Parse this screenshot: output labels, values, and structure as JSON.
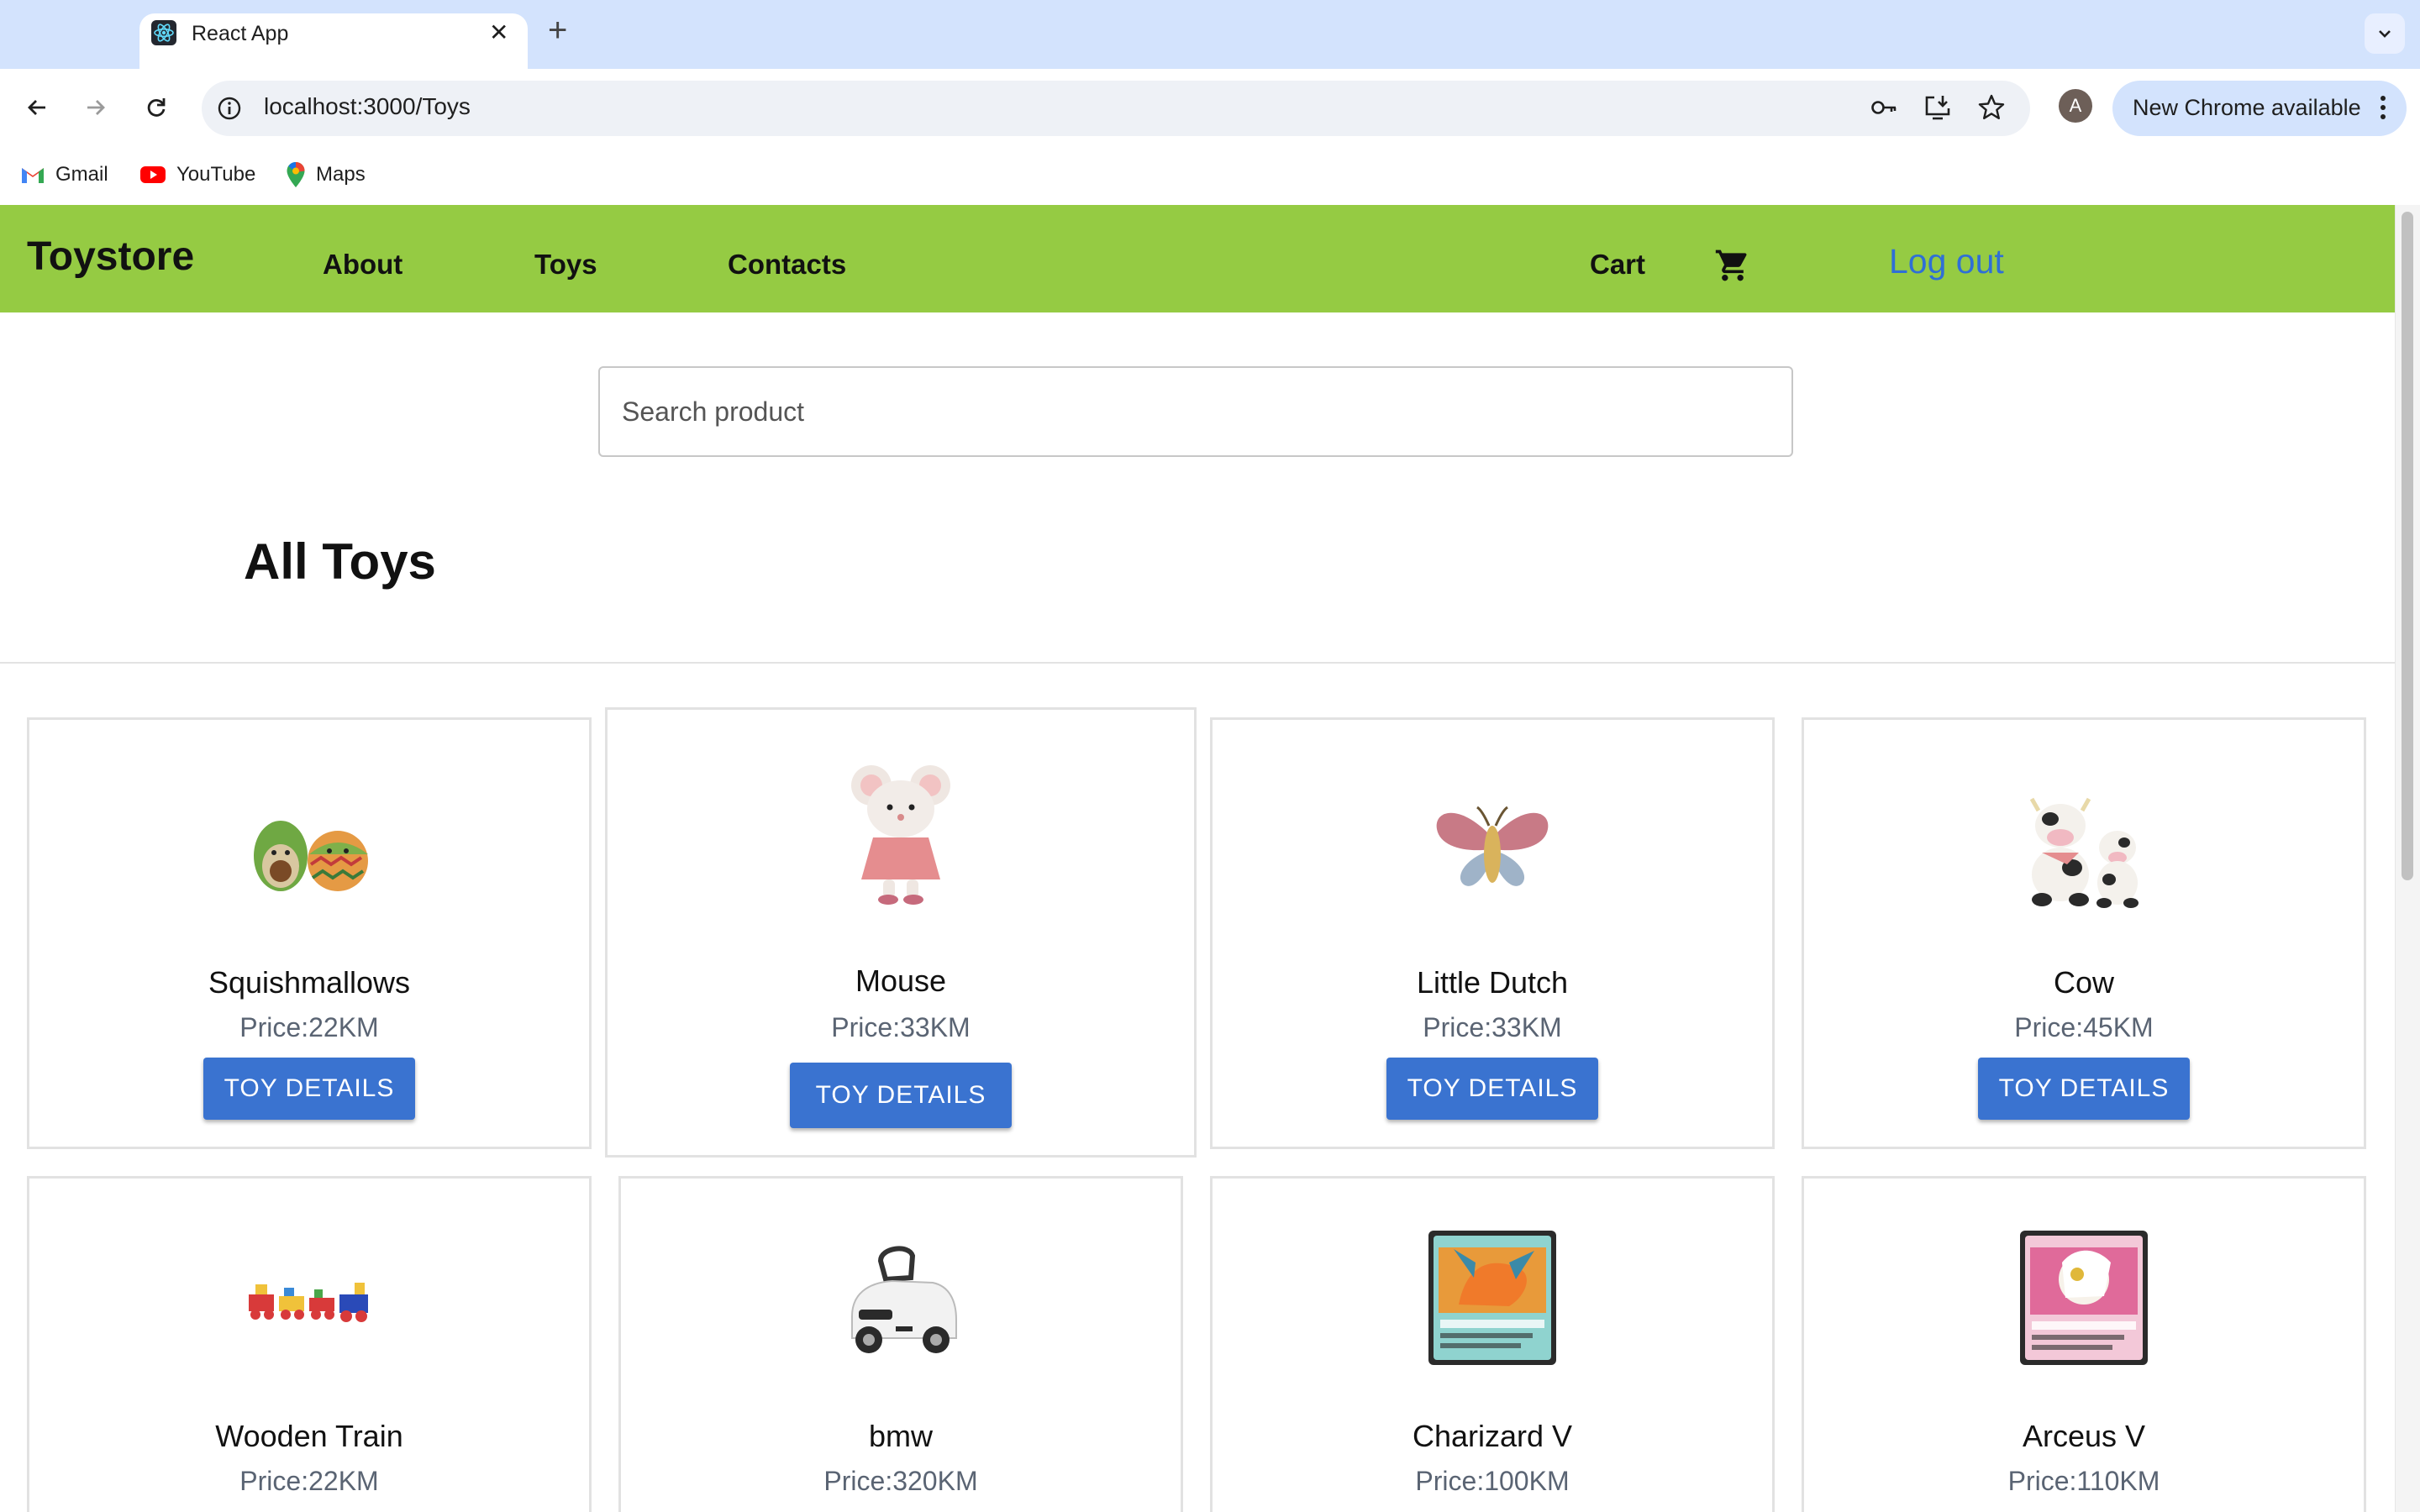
{
  "browser": {
    "tab_title": "React App",
    "url": "localhost:3000/Toys",
    "update_label": "New Chrome available",
    "avatar_letter": "A",
    "bookmarks": [
      {
        "label": "Gmail",
        "icon": "gmail-icon"
      },
      {
        "label": "YouTube",
        "icon": "youtube-icon"
      },
      {
        "label": "Maps",
        "icon": "maps-icon"
      }
    ]
  },
  "nav": {
    "brand": "Toystore",
    "links": [
      "About",
      "Toys",
      "Contacts"
    ],
    "cart": "Cart",
    "logout": "Log out",
    "color": "#95cb43"
  },
  "search": {
    "placeholder": "Search product"
  },
  "main": {
    "title": "All Toys",
    "button_label": "TOY DETAILS",
    "products": [
      {
        "name": "Squishmallows",
        "price": "Price:22KM"
      },
      {
        "name": "Mouse",
        "price": "Price:33KM"
      },
      {
        "name": "Little Dutch",
        "price": "Price:33KM"
      },
      {
        "name": "Cow",
        "price": "Price:45KM"
      },
      {
        "name": "Wooden Train",
        "price": "Price:22KM"
      },
      {
        "name": "bmw",
        "price": "Price:320KM"
      },
      {
        "name": "Charizard V",
        "price": "Price:100KM"
      },
      {
        "name": "Arceus V",
        "price": "Price:110KM"
      }
    ]
  },
  "colors": {
    "button": "#3a73d0",
    "link": "#2f6fd6"
  }
}
